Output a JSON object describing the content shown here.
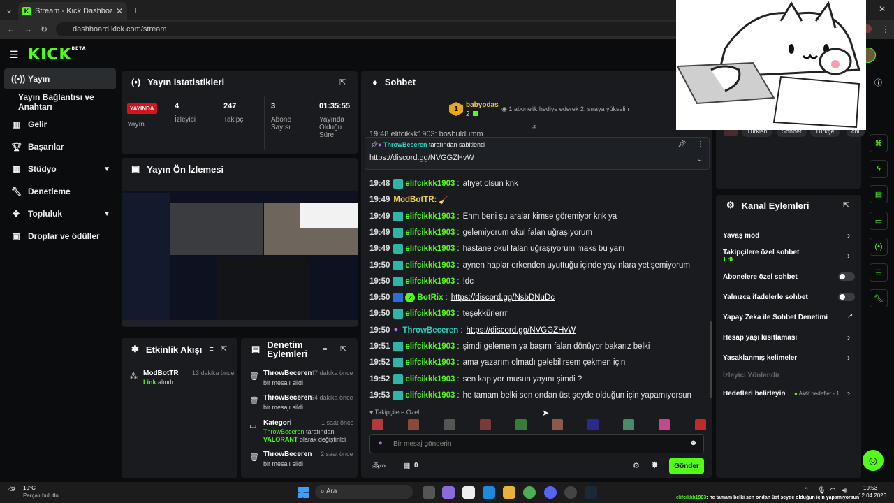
{
  "browser": {
    "tab_title": "Stream - Kick Dashboard",
    "url": "dashboard.kick.com/stream"
  },
  "logo": {
    "text": "KICK",
    "beta": "BETA"
  },
  "sidebar": {
    "items": [
      {
        "label": "Yayın",
        "icon": "broadcast-icon"
      },
      {
        "label": "Yayın Bağlantısı ve Anahtarı"
      },
      {
        "label": "Gelir",
        "icon": "chart-icon"
      },
      {
        "label": "Başarılar",
        "icon": "trophy-icon"
      },
      {
        "label": "Stüdyo",
        "icon": "studio-icon"
      },
      {
        "label": "Denetleme",
        "icon": "wrench-icon"
      },
      {
        "label": "Topluluk",
        "icon": "community-icon"
      },
      {
        "label": "Droplar ve ödüller",
        "icon": "gift-icon"
      }
    ]
  },
  "stats": {
    "title": "Yayın İstatistikleri",
    "live_badge": "YAYINDA",
    "live_label": "Yayın",
    "viewers": "4",
    "viewers_label": "İzleyici",
    "followers": "247",
    "followers_label": "Takipçi",
    "subs": "3",
    "subs_label": "Abone Sayısı",
    "uptime": "01:35:55",
    "uptime_label": "Yayında Olduğu Süre"
  },
  "preview": {
    "title": "Yayın Ön İzlemesi"
  },
  "activity": {
    "title": "Etkinlik Akışı",
    "item": {
      "user": "ModBotTR",
      "time": "13 dakika önce",
      "highlight": "Link",
      "rest": " alındı"
    }
  },
  "modactions": {
    "title": "Denetim Eylemleri",
    "items": [
      {
        "user": "ThrowBeceren",
        "time": "47 dakika önce",
        "text": "bir mesajı sildi"
      },
      {
        "user": "ThrowBeceren",
        "time": "54 dakika önce",
        "text": "bir mesajı sildi"
      },
      {
        "user": "Kategori",
        "time": "1 saat önce",
        "text1": "ThrowBeceren",
        "text2": " tarafından",
        "text3": "VALORANT",
        "text4": " olarak değiştirildi"
      },
      {
        "user": "ThrowBeceren",
        "time": "2 saat önce",
        "text": "bir mesajı sildi"
      }
    ]
  },
  "chat": {
    "title": "Sohbet",
    "gifter": "babyodas",
    "gifter_count": "2",
    "gift_note": "1 abonelik hediye ederek 2. sıraya yükselin",
    "pinned_by": "ThrowBeceren",
    "pinned_suffix": " tarafından sabitlendi",
    "pinned_link": "https://discord.gg/NVGGZHvW",
    "partial_top": "19:48  elifcikkk1903: bosbuldumm",
    "messages": [
      {
        "time": "19:48",
        "user": "elifcikkk1903",
        "text": "afiyet olsun knk",
        "color": "#53fc18"
      },
      {
        "time": "19:49",
        "user": "ModBotTR:",
        "text": "",
        "color": "#f5d547"
      },
      {
        "time": "19:49",
        "user": "elifcikkk1903",
        "text": "Ehm beni şu aralar kimse göremiyor knk ya",
        "color": "#53fc18"
      },
      {
        "time": "19:49",
        "user": "elifcikkk1903",
        "text": "gelemiyorum okul falan uğraşıyorum",
        "color": "#53fc18"
      },
      {
        "time": "19:49",
        "user": "elifcikkk1903",
        "text": "hastane okul falan uğraşıyorum maks bu yani",
        "color": "#53fc18"
      },
      {
        "time": "19:50",
        "user": "elifcikkk1903",
        "text": "aynen haplar erkenden uyuttuğu içinde yayınlara yetişemiyorum",
        "color": "#53fc18"
      },
      {
        "time": "19:50",
        "user": "elifcikkk1903",
        "text": "!dc",
        "color": "#53fc18"
      },
      {
        "time": "19:50",
        "user": "BotRix",
        "text": "https://discord.gg/NsbDNuDc",
        "color": "#53fc18"
      },
      {
        "time": "19:50",
        "user": "elifcikkk1903",
        "text": "teşekkürlerrr",
        "color": "#53fc18"
      },
      {
        "time": "19:50",
        "user": "ThrowBeceren",
        "text": "https://discord.gg/NVGGZHvW",
        "color": "#2ad0c0"
      },
      {
        "time": "19:51",
        "user": "elifcikkk1903",
        "text": "şimdi gelemem ya başım falan dönüyor bakarız belki",
        "color": "#53fc18"
      },
      {
        "time": "19:52",
        "user": "elifcikkk1903",
        "text": "ama yazarım olmadı gelebilirsem çekmen için",
        "color": "#53fc18"
      },
      {
        "time": "19:52",
        "user": "elifcikkk1903",
        "text": "sen kapıyor musun yayını şimdi ?",
        "color": "#53fc18"
      },
      {
        "time": "19:53",
        "user": "elifcikkk1903",
        "text": "he tamam belki sen ondan üst şeyde olduğun için yapamıyorsun",
        "color": "#53fc18"
      }
    ],
    "followers_only": "Takipçilere Özel",
    "input_placeholder": "Bir mesaj gönderin",
    "points": "0",
    "send": "Gönder"
  },
  "tags": [
    "Türkish",
    "Sohbet",
    "Türkçe",
    "chi"
  ],
  "channel_actions": {
    "title": "Kanal Eylemleri",
    "slow": "Yavaş mod",
    "followers": "Takipçilere özel sohbet",
    "followers_sub": "1 dk.",
    "subs": "Abonelere özel sohbet",
    "emotes": "Yalnızca ifadelerle sohbet",
    "ai": "Yapay Zeka ile Sohbet Denetimi",
    "age": "Hesap yaşı kısıtlaması",
    "banned": "Yasaklanmış kelimeler",
    "redirect": "İzleyici Yönlendir",
    "goals": "Hedefleri belirleyin",
    "goals_status": "Aktif hedefler - 1"
  },
  "taskbar": {
    "temp": "10°C",
    "weather": "Parçalı bulutlu",
    "search": "Ara",
    "clock": "19:53",
    "date": "12.04.2026",
    "ticker_user": "elifcikkk1903",
    "ticker_text": ": he tamam belki sen ondan üst şeyde olduğun için yapamıyorsun"
  }
}
